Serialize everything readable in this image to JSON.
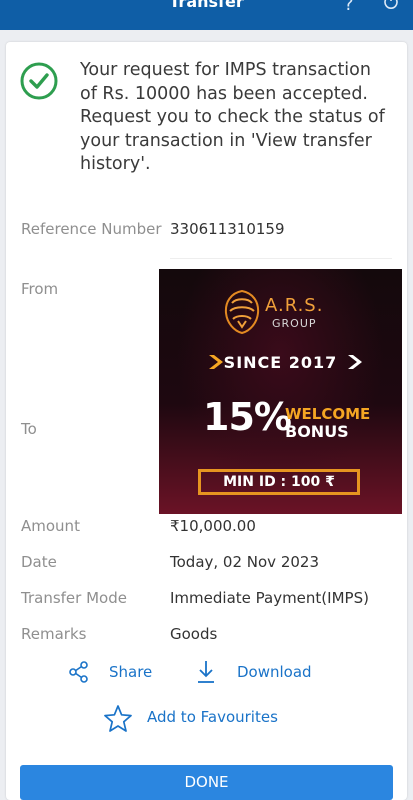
{
  "header": {
    "title": "Transfer",
    "help_icon_text": "?"
  },
  "message": "Your request for IMPS transaction of Rs. 10000 has been accepted. Request you to check the status of your transaction in 'View transfer history'.",
  "details": {
    "reference_label": "Reference Number",
    "reference_value": "330611310159",
    "from_label": "From",
    "to_label": "To",
    "amount_label": "Amount",
    "amount_value": "₹10,000.00",
    "date_label": "Date",
    "date_value": "Today, 02 Nov 2023",
    "mode_label": "Transfer Mode",
    "mode_value": "Immediate Payment(IMPS)",
    "remarks_label": "Remarks",
    "remarks_value": "Goods"
  },
  "ad": {
    "brand": "A.R.S.",
    "group": "GROUP",
    "since": "SINCE 2017",
    "percent": "15%",
    "welcome": "WELCOME",
    "bonus": "BONUS",
    "min_id": "MIN ID : 100 ₹"
  },
  "actions": {
    "share": "Share",
    "download": "Download",
    "favourites": "Add to Favourites"
  },
  "done": "DONE",
  "colors": {
    "header": "#0f5ea6",
    "accent": "#1a73c8",
    "success": "#2e9e4f",
    "ad_orange": "#f5a623"
  }
}
